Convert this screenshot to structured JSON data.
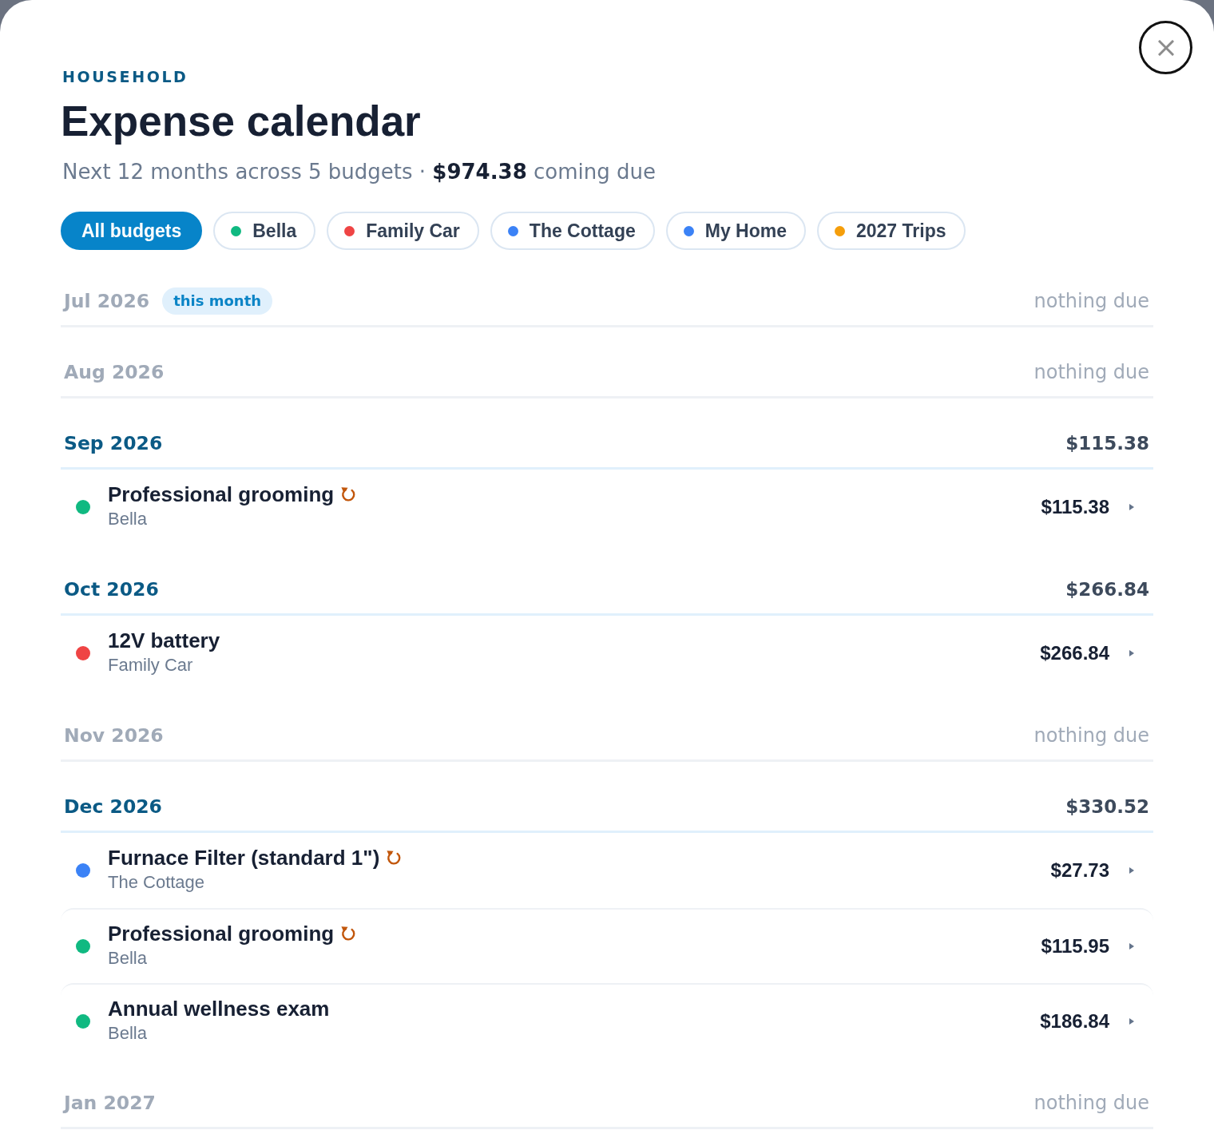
{
  "eyebrow": "HOUSEHOLD",
  "title": "Expense calendar",
  "summary": "Next 12 months across 5 budgets · **$974.38** coming due",
  "filters": [
    {
      "label": "All budgets",
      "selected": true
    },
    {
      "label": "Bella",
      "color": "#10b981",
      "selected": false
    },
    {
      "label": "Family Car",
      "color": "#ef4444",
      "selected": false
    },
    {
      "label": "The Cottage",
      "color": "#3b82f6",
      "selected": false
    },
    {
      "label": "My Home",
      "color": "#3b82f6",
      "selected": false
    },
    {
      "label": "2027 Trips",
      "color": "#f59e0b",
      "selected": false
    }
  ],
  "months": [
    {
      "kind": "empty",
      "label": "Jul 2026",
      "badge": "this month",
      "status": "nothing due"
    },
    {
      "kind": "empty",
      "label": "Aug 2026",
      "status": "nothing due"
    },
    {
      "kind": "due",
      "label": "Sep 2026",
      "total": "$115.38",
      "items": [
        {
          "name": "Professional grooming",
          "recurring": true,
          "budget": "Bella",
          "color": "#10b981",
          "amount": "$115.38"
        }
      ]
    },
    {
      "kind": "due",
      "label": "Oct 2026",
      "total": "$266.84",
      "items": [
        {
          "name": "12V battery",
          "recurring": false,
          "budget": "Family Car",
          "color": "#ef4444",
          "amount": "$266.84"
        }
      ]
    },
    {
      "kind": "empty",
      "label": "Nov 2026",
      "status": "nothing due"
    },
    {
      "kind": "due",
      "label": "Dec 2026",
      "total": "$330.52",
      "items": [
        {
          "name": "Furnace Filter (standard 1\")",
          "recurring": true,
          "budget": "The Cottage",
          "color": "#3b82f6",
          "amount": "$27.73"
        },
        {
          "name": "Professional grooming",
          "recurring": true,
          "budget": "Bella",
          "color": "#10b981",
          "amount": "$115.95"
        },
        {
          "name": "Annual wellness exam",
          "recurring": false,
          "budget": "Bella",
          "color": "#10b981",
          "amount": "$186.84"
        }
      ]
    },
    {
      "kind": "empty",
      "label": "Jan 2027",
      "status": "nothing due"
    }
  ]
}
